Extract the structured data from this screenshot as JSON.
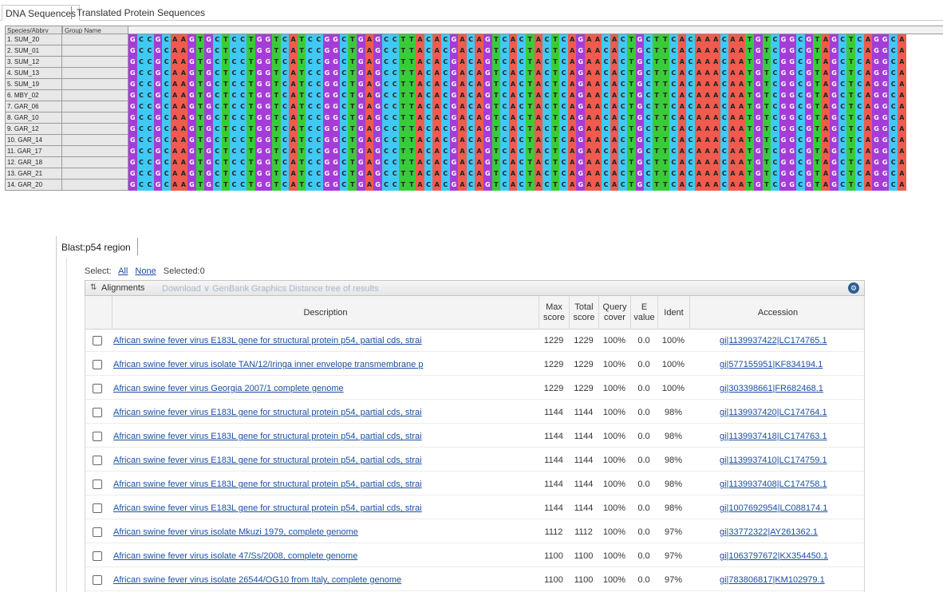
{
  "tabs": [
    "DNA Sequences",
    "Translated Protein Sequences"
  ],
  "grid": {
    "headers": [
      "Species/Abbrv",
      "Group Name"
    ],
    "sequence": "GCCGCAAGTGCTCCTGGTCATCCGGCTGAGCCTTACACGACAGTCACTACTCAGAACACTGCTTCACAAACAATGTCGGCGTAGCTCAGGCA",
    "rows": [
      "1. SUM_20",
      "2. SUM_01",
      "3. SUM_12",
      "4. SUM_13",
      "5. SUM_19",
      "6. MBY_02",
      "7. GAR_06",
      "8. GAR_10",
      "9. GAR_12",
      "10. GAR_14",
      "11. GAR_17",
      "12. GAR_18",
      "13. GAR_21",
      "14. GAR_20"
    ],
    "colors": {
      "A": "#f05b4f",
      "C": "#40c9f4",
      "G": "#a43dd8",
      "T": "#3acb3a"
    }
  },
  "blast": {
    "tab_label": "Blast:p54 region",
    "select_label": "Select:",
    "all": "All",
    "none": "None",
    "selected": "Selected:0",
    "alignments_title": "Alignments",
    "toolbar_links": "Download ∨ GenBank Graphics Distance tree of results",
    "columns": [
      "Description",
      "Max score",
      "Total score",
      "Query cover",
      "E value",
      "Ident",
      "Accession"
    ],
    "results": [
      {
        "desc": "African swine fever virus E183L gene for structural protein p54, partial cds, strai",
        "max": "1229",
        "total": "1229",
        "cover": "100%",
        "e": "0.0",
        "ident": "100%",
        "acc": "gi|1139937422|LC174765.1"
      },
      {
        "desc": "African swine fever virus isolate TAN/12/Iringa inner envelope transmembrane p",
        "max": "1229",
        "total": "1229",
        "cover": "100%",
        "e": "0.0",
        "ident": "100%",
        "acc": "gi|577155951|KF834194.1"
      },
      {
        "desc": "African swine fever virus Georgia 2007/1 complete genome",
        "max": "1229",
        "total": "1229",
        "cover": "100%",
        "e": "0.0",
        "ident": "100%",
        "acc": "gi|303398661|FR682468.1"
      },
      {
        "desc": "African swine fever virus E183L gene for structural protein p54, partial cds, strai",
        "max": "1144",
        "total": "1144",
        "cover": "100%",
        "e": "0.0",
        "ident": "98%",
        "acc": "gi|1139937420|LC174764.1"
      },
      {
        "desc": "African swine fever virus E183L gene for structural protein p54, partial cds, strai",
        "max": "1144",
        "total": "1144",
        "cover": "100%",
        "e": "0.0",
        "ident": "98%",
        "acc": "gi|1139937418|LC174763.1"
      },
      {
        "desc": "African swine fever virus E183L gene for structural protein p54, partial cds, strai",
        "max": "1144",
        "total": "1144",
        "cover": "100%",
        "e": "0.0",
        "ident": "98%",
        "acc": "gi|1139937410|LC174759.1"
      },
      {
        "desc": "African swine fever virus E183L gene for structural protein p54, partial cds, strai",
        "max": "1144",
        "total": "1144",
        "cover": "100%",
        "e": "0.0",
        "ident": "98%",
        "acc": "gi|1139937408|LC174758.1"
      },
      {
        "desc": "African swine fever virus E183L gene for structural protein p54, partial cds, strai",
        "max": "1144",
        "total": "1144",
        "cover": "100%",
        "e": "0.0",
        "ident": "98%",
        "acc": "gi|1007692954|LC088174.1"
      },
      {
        "desc": "African swine fever virus isolate Mkuzi 1979, complete genome",
        "max": "1112",
        "total": "1112",
        "cover": "100%",
        "e": "0.0",
        "ident": "97%",
        "acc": "gi|33772322|AY261362.1"
      },
      {
        "desc": "African swine fever virus isolate 47/Ss/2008, complete genome",
        "max": "1100",
        "total": "1100",
        "cover": "100%",
        "e": "0.0",
        "ident": "97%",
        "acc": "gi|1063797672|KX354450.1"
      },
      {
        "desc": "African swine fever virus isolate 26544/OG10 from Italy, complete genome",
        "max": "1100",
        "total": "1100",
        "cover": "100%",
        "e": "0.0",
        "ident": "97%",
        "acc": "gi|783806817|KM102979.1"
      }
    ]
  }
}
